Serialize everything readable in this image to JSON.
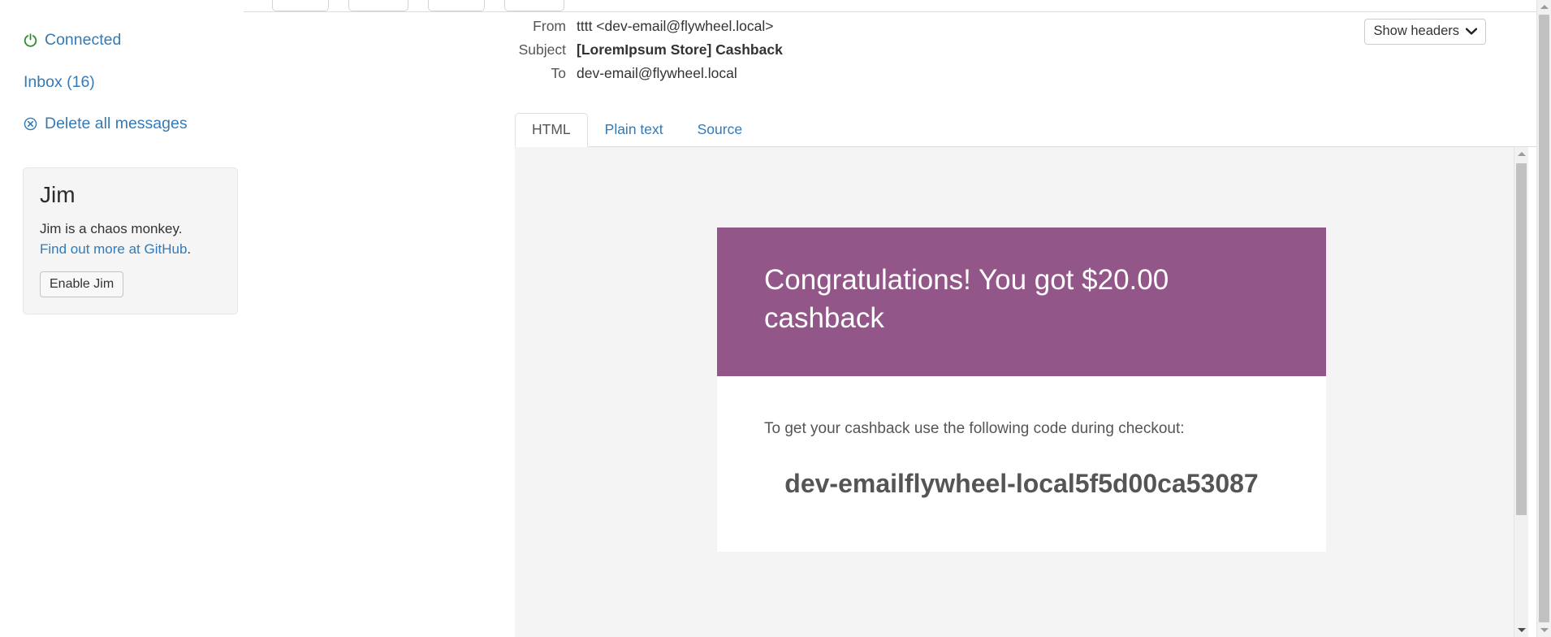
{
  "sidebar": {
    "connected": {
      "label": "Connected",
      "icon": "power-icon",
      "color": "#2e8b2e"
    },
    "inbox": {
      "label": "Inbox (16)",
      "count": 16
    },
    "delete_all": {
      "label": "Delete all messages",
      "icon": "circle-x-icon"
    },
    "jim": {
      "title": "Jim",
      "description": "Jim is a chaos monkey.",
      "link_label": "Find out more at GitHub",
      "link_suffix": ".",
      "button_label": "Enable Jim"
    }
  },
  "toolbar": {
    "show_headers_label": "Show headers",
    "chevron": "❯"
  },
  "message": {
    "headers": [
      {
        "key": "From",
        "value": "tttt <dev-email@flywheel.local>",
        "bold": false
      },
      {
        "key": "Subject",
        "value": "[LoremIpsum Store] Cashback",
        "bold": true
      },
      {
        "key": "To",
        "value": "dev-email@flywheel.local",
        "bold": false
      }
    ],
    "tabs": [
      {
        "label": "HTML",
        "active": true
      },
      {
        "label": "Plain text",
        "active": false
      },
      {
        "label": "Source",
        "active": false
      }
    ],
    "body": {
      "banner_text": "Congratulations! You got $20.00 cashback",
      "banner_color": "#935688",
      "intro": "To get your cashback use the following code during checkout:",
      "code": "dev-emailflywheel-local5f5d00ca53087"
    }
  },
  "colors": {
    "link": "#337ab7",
    "accent_purple": "#935688",
    "connected_green": "#2e8b2e"
  }
}
